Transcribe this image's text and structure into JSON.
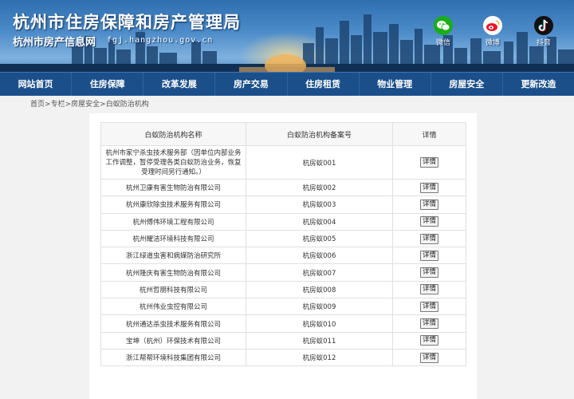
{
  "header": {
    "title": "杭州市住房保障和房产管理局",
    "subtitle": "杭州市房产信息网",
    "domain": "fgj.hangzhou.gov.cn",
    "social": [
      {
        "label": "微信",
        "icon": "wechat-icon"
      },
      {
        "label": "微博",
        "icon": "weibo-icon"
      },
      {
        "label": "抖音",
        "icon": "douyin-icon"
      }
    ]
  },
  "nav": {
    "items": [
      "网站首页",
      "住房保障",
      "改革发展",
      "房产交易",
      "住房租赁",
      "物业管理",
      "房屋安全",
      "更新改造"
    ]
  },
  "breadcrumb": {
    "home": "首页",
    "sep": ">",
    "level1": "专栏",
    "level2": "房屋安全",
    "current": "白蚁防治机构"
  },
  "table": {
    "headers": [
      "白蚁防治机构名称",
      "白蚁防治机构备案号",
      "详情"
    ],
    "detail_label": "详情",
    "rows": [
      {
        "name": "杭州市家宁杀虫技术服务部（因单位内部业务工作调整，暂停受理各类白蚁防治业务，恢复受理时间另行通知。）",
        "code": "杭房蚁001"
      },
      {
        "name": "杭州卫康有害生物防治有限公司",
        "code": "杭房蚁002"
      },
      {
        "name": "杭州康欣除虫技术服务有限公司",
        "code": "杭房蚁003"
      },
      {
        "name": "杭州傅伟环境工程有限公司",
        "code": "杭房蚁004"
      },
      {
        "name": "杭州耀洁环境科技有限公司",
        "code": "杭房蚁005"
      },
      {
        "name": "浙江绿道虫害和病媒防治研究所",
        "code": "杭房蚁006"
      },
      {
        "name": "杭州隆庆有害生物防治有限公司",
        "code": "杭房蚁007"
      },
      {
        "name": "杭州哲朋科技有限公司",
        "code": "杭房蚁008"
      },
      {
        "name": "杭州伟业虫控有限公司",
        "code": "杭房蚁009"
      },
      {
        "name": "杭州通达杀虫技术服务有限公司",
        "code": "杭房蚁010"
      },
      {
        "name": "宝坤（杭州）环保技术有限公司",
        "code": "杭房蚁011"
      },
      {
        "name": "浙江帮帮环境科技集团有限公司",
        "code": "杭房蚁012"
      }
    ]
  },
  "colors": {
    "nav_bg": "#1a4f8a",
    "banner_top": "#2f6fb0",
    "table_border": "#e0e0e0"
  }
}
